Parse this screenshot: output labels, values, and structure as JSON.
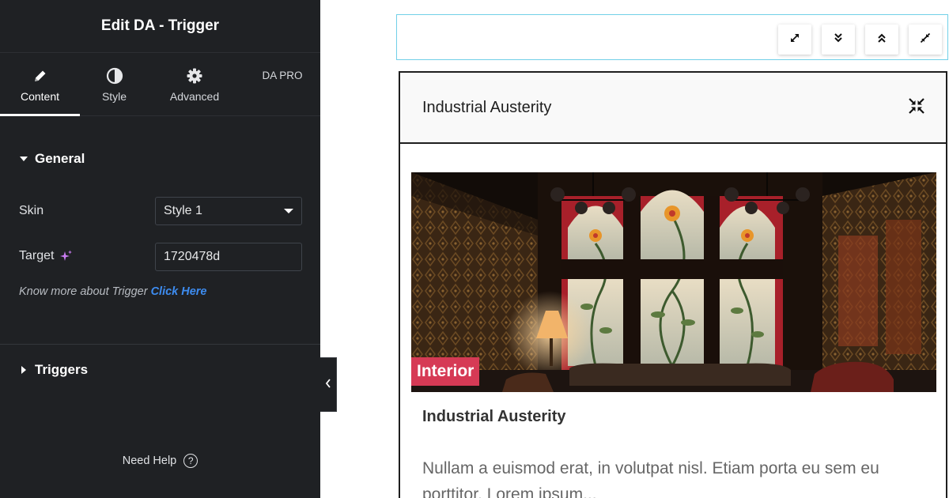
{
  "panel": {
    "title": "Edit DA - Trigger",
    "tabs": [
      {
        "label": "Content",
        "icon": "pencil-icon"
      },
      {
        "label": "Style",
        "icon": "half-circle-icon"
      },
      {
        "label": "Advanced",
        "icon": "gear-icon"
      },
      {
        "label": "DA PRO",
        "icon": ""
      }
    ],
    "active_tab": "Content",
    "general": {
      "heading": "General",
      "skin_label": "Skin",
      "skin_value": "Style 1",
      "target_label": "Target",
      "target_value": "1720478d",
      "help_text": "Know more about Trigger ",
      "help_link": "Click Here"
    },
    "triggers_heading": "Triggers",
    "need_help": "Need Help",
    "colors": {
      "panel_bg": "#1f2124",
      "link": "#3d8cf0",
      "ai_sparkle": "#c97cf2"
    }
  },
  "preview": {
    "toolbar_buttons": [
      "expand-icon",
      "chevrons-down-icon",
      "chevrons-up-icon",
      "collapse-icon"
    ],
    "card_header_title": "Industrial Austerity",
    "badge": "Interior",
    "post_title": "Industrial Austerity",
    "excerpt": "Nullam a euismod erat, in volutpat nisl. Etiam porta eu sem eu porttitor. Lorem ipsum...",
    "colors": {
      "badge": "#d63a55",
      "toolbar_border": "#71d0e8"
    }
  }
}
